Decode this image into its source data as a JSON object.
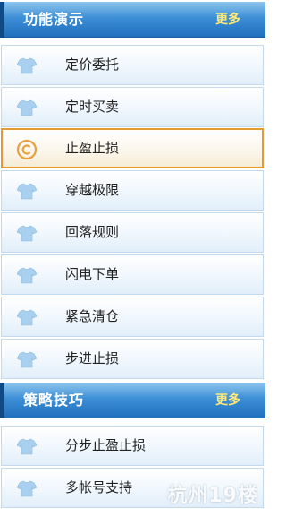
{
  "section1": {
    "title": "功能演示",
    "more": "更多",
    "items": [
      {
        "label": "定价委托",
        "icon": "shirt-icon"
      },
      {
        "label": "定时买卖",
        "icon": "shirt-icon"
      },
      {
        "label": "止盈止损",
        "icon": "copyright-icon",
        "active": true
      },
      {
        "label": "穿越极限",
        "icon": "shirt-icon"
      },
      {
        "label": "回落规则",
        "icon": "shirt-icon"
      },
      {
        "label": "闪电下单",
        "icon": "shirt-icon"
      },
      {
        "label": "紧急清仓",
        "icon": "shirt-icon"
      },
      {
        "label": "步进止损",
        "icon": "shirt-icon"
      }
    ]
  },
  "section2": {
    "title": "策略技巧",
    "more": "更多",
    "items": [
      {
        "label": "分步止盈止损",
        "icon": "shirt-icon"
      },
      {
        "label": "多帐号支持",
        "icon": "shirt-icon"
      }
    ]
  },
  "watermark": "杭州19楼",
  "colors": {
    "header_top": "#8fc6ee",
    "header_bottom": "#1f6fbe",
    "more_text": "#ffe97a",
    "active_border": "#e69a2e",
    "icon_blue": "#a9d0ee"
  }
}
